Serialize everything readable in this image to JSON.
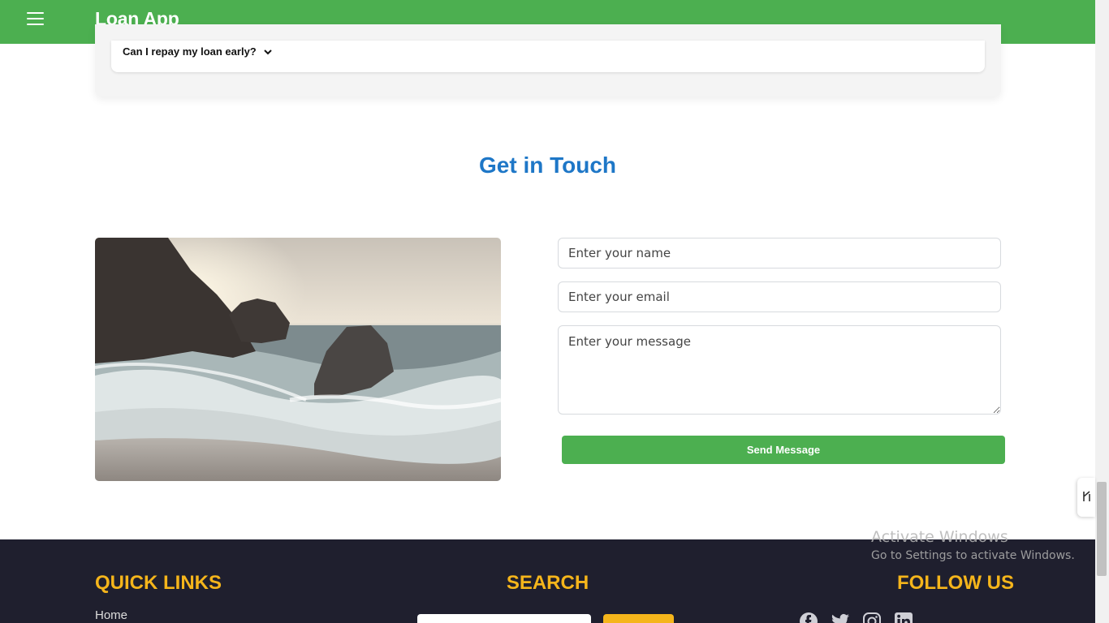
{
  "header": {
    "title": "Loan App",
    "menu_icon": "hamburger-menu-icon",
    "color": "#4caf50"
  },
  "faq": {
    "question": "Can I repay my loan early?",
    "toggle_icon": "chevron-down-icon"
  },
  "contact": {
    "title": "Get in Touch",
    "image_alt": "",
    "name_placeholder": "Enter your name",
    "email_placeholder": "Enter your email",
    "message_placeholder": "Enter your message",
    "send_label": "Send Message",
    "button_color": "#4caf50",
    "title_color": "#1e77c7"
  },
  "footer": {
    "quick_links_title": "QUICK LINKS",
    "search_title": "SEARCH",
    "follow_title": "FOLLOW US",
    "links": [
      "Home"
    ],
    "social_icons": [
      "facebook-icon",
      "twitter-icon",
      "instagram-icon",
      "linkedin-icon"
    ],
    "accent": "#f5b51b",
    "background": "#1f1f2e"
  },
  "watermark": {
    "line1": "Activate Windows",
    "line2": "Go to Settings to activate Windows."
  }
}
